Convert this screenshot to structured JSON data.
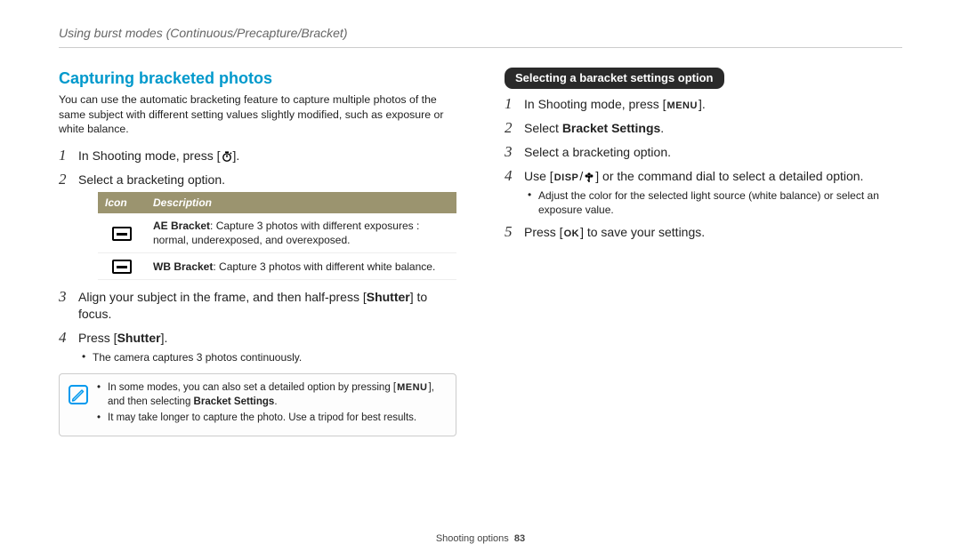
{
  "breadcrumb": "Using burst modes (Continuous/Precapture/Bracket)",
  "section_title": "Capturing bracketed photos",
  "intro": "You can use the automatic bracketing feature to capture multiple photos of the same subject with different setting values slightly modified, such as exposure or white balance.",
  "left_steps": [
    {
      "id": 1,
      "pre": "In Shooting mode, press [",
      "key_icon": "timer",
      "post": "]."
    },
    {
      "id": 2,
      "pre": "Select a bracketing option."
    },
    {
      "id": 3,
      "pre": "Align your subject in the frame, and then half-press [",
      "bold": "Shutter",
      "post": "] to focus."
    },
    {
      "id": 4,
      "pre": "Press [",
      "bold": "Shutter",
      "post": "].",
      "sub": [
        "The camera captures 3 photos continuously."
      ]
    }
  ],
  "table": {
    "headers": [
      "Icon",
      "Description"
    ],
    "rows": [
      {
        "icon": "ae-bracket-icon",
        "label_bold": "AE Bracket",
        "desc": ": Capture 3 photos with different exposures : normal, underexposed, and overexposed."
      },
      {
        "icon": "wb-bracket-icon",
        "label_bold": "WB Bracket",
        "desc": ": Capture 3 photos with different white balance."
      }
    ]
  },
  "note": {
    "items": [
      {
        "pre": "In some modes, you can also set a detailed option by pressing [",
        "key": "MENU",
        "mid": "], and then selecting ",
        "bold": "Bracket Settings",
        "post": "."
      },
      {
        "pre": "It may take longer to capture the photo. Use a tripod for best results."
      }
    ]
  },
  "right": {
    "tab": "Selecting a baracket settings option",
    "steps": [
      {
        "pre": "In Shooting mode, press [",
        "key": "MENU",
        "post": "]."
      },
      {
        "pre": "Select ",
        "bold": "Bracket Settings",
        "post": "."
      },
      {
        "pre": "Select a bracketing option."
      },
      {
        "pre": "Use [",
        "key": "DISP",
        "slash": "/",
        "key_icon": "flower",
        "post": "] or the command dial to select a detailed option.",
        "sub": [
          "Adjust the color for the selected light source (white balance) or select an exposure value."
        ]
      },
      {
        "pre": "Press [",
        "key": "OK",
        "post": "] to save your settings."
      }
    ]
  },
  "footer": {
    "section": "Shooting options",
    "page": "83"
  }
}
